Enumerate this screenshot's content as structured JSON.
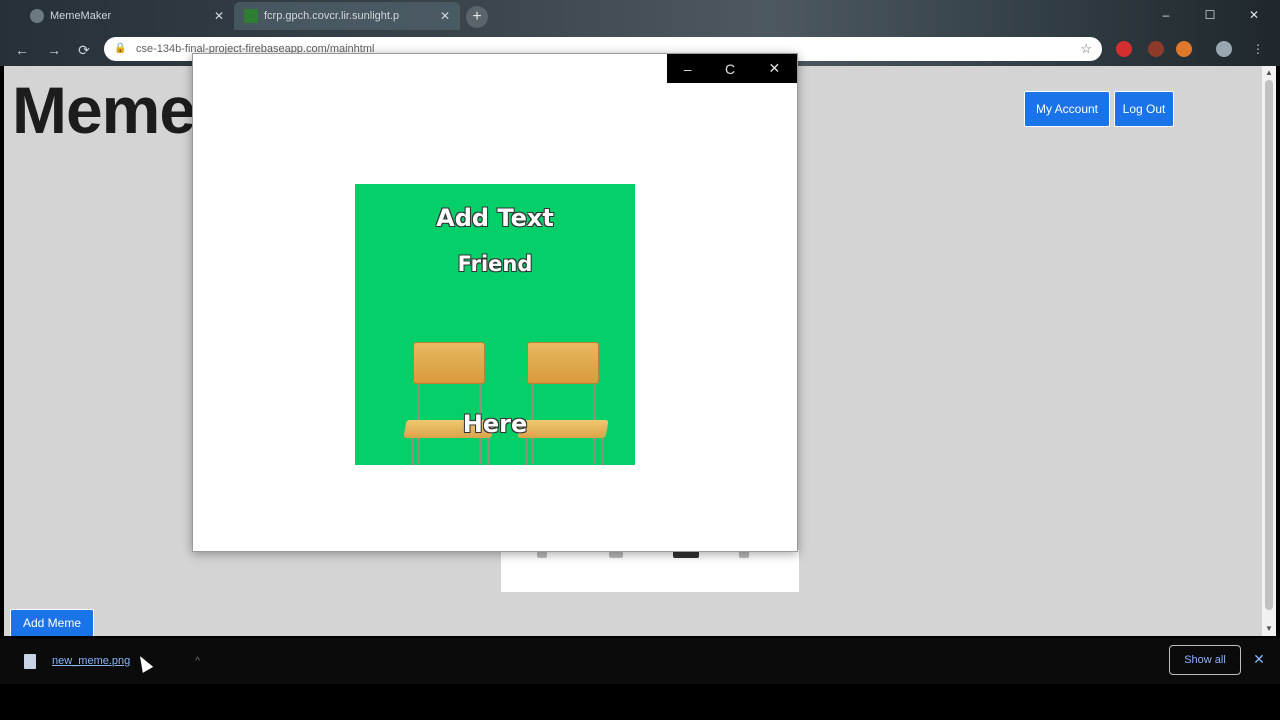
{
  "browser": {
    "tabs": [
      {
        "title": "MemeMaker",
        "icon": "globe-icon",
        "active": false
      },
      {
        "title": "fcrp.gpch.covcr.lir.sunlight.p",
        "icon": "sheet-icon",
        "active": true
      }
    ],
    "new_tab_symbol": "+",
    "window_controls": {
      "minimize": "–",
      "maximize": "☐",
      "close": "✕"
    },
    "nav": {
      "back": "←",
      "forward": "→",
      "reload": "⟳"
    },
    "url": "cse-134b-final-project-firebaseapp.com/mainhtml",
    "bookmark_symbol": "☆"
  },
  "page": {
    "title": "Meme",
    "buttons": {
      "my_account": "My Account",
      "log_out": "Log Out",
      "add_meme": "Add Meme"
    }
  },
  "popup": {
    "controls": {
      "minimize": "–",
      "restore": "C",
      "close": "✕"
    },
    "meme": {
      "top_text": "Add Text",
      "middle_text": "Friend",
      "bottom_text": "Here",
      "background_color": "#05cf69"
    }
  },
  "download_shelf": {
    "file_name": "new_meme.png",
    "caret": "^",
    "show_all": "Show all",
    "close": "✕"
  },
  "colors": {
    "accent": "#1a73e8",
    "page_background": "#d4d4d4",
    "link": "#8ab4f8"
  }
}
